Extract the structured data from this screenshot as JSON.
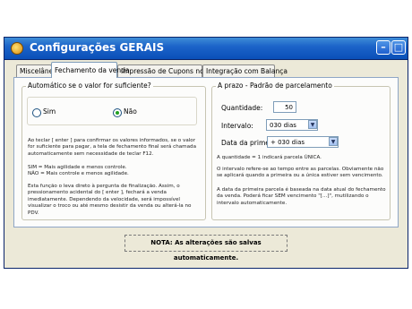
{
  "window": {
    "title": "Configurações GERAIS"
  },
  "tabs": [
    {
      "label": "Miscelânea"
    },
    {
      "label": "Fechamento da venda"
    },
    {
      "label": "Impressão de Cupons no PDV"
    },
    {
      "label": "Integração com Balança"
    }
  ],
  "left_group": {
    "caption": "Automático se o valor for suficiente?",
    "options": [
      {
        "label": "Sim",
        "selected": false
      },
      {
        "label": "Não",
        "selected": true
      }
    ],
    "help1": "Ao teclar [ enter ] para confirmar os valores informados, se o valor for suficiente para pagar, a tela de fechamento final será chamada automaticamente sem necessidade de teclar F12.",
    "help2a": "SIM = Mais agilidade e menos controle.",
    "help2b": "NÃO = Mais controle e menos agilidade.",
    "help3": "Esta função o leva direto à pergunta de finalização. Assim, o pressionamento acidental do [ enter ], fechará a venda imediatamente. Dependendo da velocidade, será impossível visualizar o troco ou até mesmo desistir da venda ou alterá-la no PDV."
  },
  "right_group": {
    "caption": "A prazo - Padrão de parcelamento",
    "quantidade_label": "Quantidade:",
    "quantidade_value": "50",
    "intervalo_label": "Intervalo:",
    "intervalo_value": "030 dias",
    "data_label": "Data da primeira:",
    "data_value": "+ 030 dias",
    "help1": "A quantidade = 1 indicará parcela ÚNICA.",
    "help2": "O intervalo refere-se ao tempo entre as parcelas. Obviamente não se aplicará quando a primeira ou a única estiver sem vencimento.",
    "help3": "A data da primeira parcela é baseada na data atual do fechamento da venda. Poderá ficar SEM vencimento \"[...]\", mutilizando o intervalo automaticamente."
  },
  "note": "NOTA: As alterações são salvas automaticamente.",
  "icons": {
    "app": "gear-coin-icon",
    "minimize": "minimize-icon",
    "maximize": "maximize-icon",
    "close": "close-icon",
    "dropdown": "chevron-down-icon"
  },
  "colors": {
    "titlebar": "#1c64c9",
    "window_bg": "#ece9d8",
    "panel_bg": "#fcfcfb",
    "radio_dot": "#21a121"
  }
}
